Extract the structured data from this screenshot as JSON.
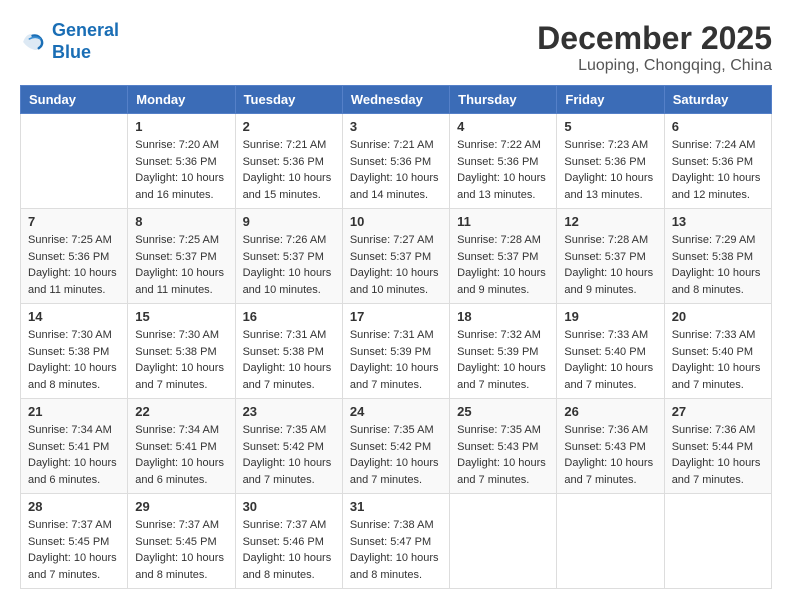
{
  "header": {
    "logo_line1": "General",
    "logo_line2": "Blue",
    "month": "December 2025",
    "location": "Luoping, Chongqing, China"
  },
  "weekdays": [
    "Sunday",
    "Monday",
    "Tuesday",
    "Wednesday",
    "Thursday",
    "Friday",
    "Saturday"
  ],
  "weeks": [
    [
      {
        "day": "",
        "sunrise": "",
        "sunset": "",
        "daylight": ""
      },
      {
        "day": "1",
        "sunrise": "7:20 AM",
        "sunset": "5:36 PM",
        "daylight": "10 hours and 16 minutes."
      },
      {
        "day": "2",
        "sunrise": "7:21 AM",
        "sunset": "5:36 PM",
        "daylight": "10 hours and 15 minutes."
      },
      {
        "day": "3",
        "sunrise": "7:21 AM",
        "sunset": "5:36 PM",
        "daylight": "10 hours and 14 minutes."
      },
      {
        "day": "4",
        "sunrise": "7:22 AM",
        "sunset": "5:36 PM",
        "daylight": "10 hours and 13 minutes."
      },
      {
        "day": "5",
        "sunrise": "7:23 AM",
        "sunset": "5:36 PM",
        "daylight": "10 hours and 13 minutes."
      },
      {
        "day": "6",
        "sunrise": "7:24 AM",
        "sunset": "5:36 PM",
        "daylight": "10 hours and 12 minutes."
      }
    ],
    [
      {
        "day": "7",
        "sunrise": "7:25 AM",
        "sunset": "5:36 PM",
        "daylight": "10 hours and 11 minutes."
      },
      {
        "day": "8",
        "sunrise": "7:25 AM",
        "sunset": "5:37 PM",
        "daylight": "10 hours and 11 minutes."
      },
      {
        "day": "9",
        "sunrise": "7:26 AM",
        "sunset": "5:37 PM",
        "daylight": "10 hours and 10 minutes."
      },
      {
        "day": "10",
        "sunrise": "7:27 AM",
        "sunset": "5:37 PM",
        "daylight": "10 hours and 10 minutes."
      },
      {
        "day": "11",
        "sunrise": "7:28 AM",
        "sunset": "5:37 PM",
        "daylight": "10 hours and 9 minutes."
      },
      {
        "day": "12",
        "sunrise": "7:28 AM",
        "sunset": "5:37 PM",
        "daylight": "10 hours and 9 minutes."
      },
      {
        "day": "13",
        "sunrise": "7:29 AM",
        "sunset": "5:38 PM",
        "daylight": "10 hours and 8 minutes."
      }
    ],
    [
      {
        "day": "14",
        "sunrise": "7:30 AM",
        "sunset": "5:38 PM",
        "daylight": "10 hours and 8 minutes."
      },
      {
        "day": "15",
        "sunrise": "7:30 AM",
        "sunset": "5:38 PM",
        "daylight": "10 hours and 7 minutes."
      },
      {
        "day": "16",
        "sunrise": "7:31 AM",
        "sunset": "5:38 PM",
        "daylight": "10 hours and 7 minutes."
      },
      {
        "day": "17",
        "sunrise": "7:31 AM",
        "sunset": "5:39 PM",
        "daylight": "10 hours and 7 minutes."
      },
      {
        "day": "18",
        "sunrise": "7:32 AM",
        "sunset": "5:39 PM",
        "daylight": "10 hours and 7 minutes."
      },
      {
        "day": "19",
        "sunrise": "7:33 AM",
        "sunset": "5:40 PM",
        "daylight": "10 hours and 7 minutes."
      },
      {
        "day": "20",
        "sunrise": "7:33 AM",
        "sunset": "5:40 PM",
        "daylight": "10 hours and 7 minutes."
      }
    ],
    [
      {
        "day": "21",
        "sunrise": "7:34 AM",
        "sunset": "5:41 PM",
        "daylight": "10 hours and 6 minutes."
      },
      {
        "day": "22",
        "sunrise": "7:34 AM",
        "sunset": "5:41 PM",
        "daylight": "10 hours and 6 minutes."
      },
      {
        "day": "23",
        "sunrise": "7:35 AM",
        "sunset": "5:42 PM",
        "daylight": "10 hours and 7 minutes."
      },
      {
        "day": "24",
        "sunrise": "7:35 AM",
        "sunset": "5:42 PM",
        "daylight": "10 hours and 7 minutes."
      },
      {
        "day": "25",
        "sunrise": "7:35 AM",
        "sunset": "5:43 PM",
        "daylight": "10 hours and 7 minutes."
      },
      {
        "day": "26",
        "sunrise": "7:36 AM",
        "sunset": "5:43 PM",
        "daylight": "10 hours and 7 minutes."
      },
      {
        "day": "27",
        "sunrise": "7:36 AM",
        "sunset": "5:44 PM",
        "daylight": "10 hours and 7 minutes."
      }
    ],
    [
      {
        "day": "28",
        "sunrise": "7:37 AM",
        "sunset": "5:45 PM",
        "daylight": "10 hours and 7 minutes."
      },
      {
        "day": "29",
        "sunrise": "7:37 AM",
        "sunset": "5:45 PM",
        "daylight": "10 hours and 8 minutes."
      },
      {
        "day": "30",
        "sunrise": "7:37 AM",
        "sunset": "5:46 PM",
        "daylight": "10 hours and 8 minutes."
      },
      {
        "day": "31",
        "sunrise": "7:38 AM",
        "sunset": "5:47 PM",
        "daylight": "10 hours and 8 minutes."
      },
      {
        "day": "",
        "sunrise": "",
        "sunset": "",
        "daylight": ""
      },
      {
        "day": "",
        "sunrise": "",
        "sunset": "",
        "daylight": ""
      },
      {
        "day": "",
        "sunrise": "",
        "sunset": "",
        "daylight": ""
      }
    ]
  ],
  "labels": {
    "sunrise_prefix": "Sunrise: ",
    "sunset_prefix": "Sunset: ",
    "daylight_prefix": "Daylight: "
  }
}
